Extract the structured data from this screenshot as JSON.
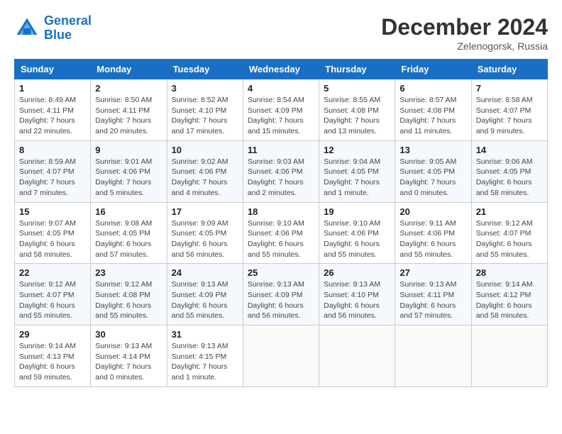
{
  "header": {
    "logo_line1": "General",
    "logo_line2": "Blue",
    "month_title": "December 2024",
    "location": "Zelenogorsk, Russia"
  },
  "weekdays": [
    "Sunday",
    "Monday",
    "Tuesday",
    "Wednesday",
    "Thursday",
    "Friday",
    "Saturday"
  ],
  "weeks": [
    [
      {
        "day": "1",
        "info": "Sunrise: 8:49 AM\nSunset: 4:11 PM\nDaylight: 7 hours\nand 22 minutes."
      },
      {
        "day": "2",
        "info": "Sunrise: 8:50 AM\nSunset: 4:11 PM\nDaylight: 7 hours\nand 20 minutes."
      },
      {
        "day": "3",
        "info": "Sunrise: 8:52 AM\nSunset: 4:10 PM\nDaylight: 7 hours\nand 17 minutes."
      },
      {
        "day": "4",
        "info": "Sunrise: 8:54 AM\nSunset: 4:09 PM\nDaylight: 7 hours\nand 15 minutes."
      },
      {
        "day": "5",
        "info": "Sunrise: 8:55 AM\nSunset: 4:08 PM\nDaylight: 7 hours\nand 13 minutes."
      },
      {
        "day": "6",
        "info": "Sunrise: 8:57 AM\nSunset: 4:08 PM\nDaylight: 7 hours\nand 11 minutes."
      },
      {
        "day": "7",
        "info": "Sunrise: 8:58 AM\nSunset: 4:07 PM\nDaylight: 7 hours\nand 9 minutes."
      }
    ],
    [
      {
        "day": "8",
        "info": "Sunrise: 8:59 AM\nSunset: 4:07 PM\nDaylight: 7 hours\nand 7 minutes."
      },
      {
        "day": "9",
        "info": "Sunrise: 9:01 AM\nSunset: 4:06 PM\nDaylight: 7 hours\nand 5 minutes."
      },
      {
        "day": "10",
        "info": "Sunrise: 9:02 AM\nSunset: 4:06 PM\nDaylight: 7 hours\nand 4 minutes."
      },
      {
        "day": "11",
        "info": "Sunrise: 9:03 AM\nSunset: 4:06 PM\nDaylight: 7 hours\nand 2 minutes."
      },
      {
        "day": "12",
        "info": "Sunrise: 9:04 AM\nSunset: 4:05 PM\nDaylight: 7 hours\nand 1 minute."
      },
      {
        "day": "13",
        "info": "Sunrise: 9:05 AM\nSunset: 4:05 PM\nDaylight: 7 hours\nand 0 minutes."
      },
      {
        "day": "14",
        "info": "Sunrise: 9:06 AM\nSunset: 4:05 PM\nDaylight: 6 hours\nand 58 minutes."
      }
    ],
    [
      {
        "day": "15",
        "info": "Sunrise: 9:07 AM\nSunset: 4:05 PM\nDaylight: 6 hours\nand 58 minutes."
      },
      {
        "day": "16",
        "info": "Sunrise: 9:08 AM\nSunset: 4:05 PM\nDaylight: 6 hours\nand 57 minutes."
      },
      {
        "day": "17",
        "info": "Sunrise: 9:09 AM\nSunset: 4:05 PM\nDaylight: 6 hours\nand 56 minutes."
      },
      {
        "day": "18",
        "info": "Sunrise: 9:10 AM\nSunset: 4:06 PM\nDaylight: 6 hours\nand 55 minutes."
      },
      {
        "day": "19",
        "info": "Sunrise: 9:10 AM\nSunset: 4:06 PM\nDaylight: 6 hours\nand 55 minutes."
      },
      {
        "day": "20",
        "info": "Sunrise: 9:11 AM\nSunset: 4:06 PM\nDaylight: 6 hours\nand 55 minutes."
      },
      {
        "day": "21",
        "info": "Sunrise: 9:12 AM\nSunset: 4:07 PM\nDaylight: 6 hours\nand 55 minutes."
      }
    ],
    [
      {
        "day": "22",
        "info": "Sunrise: 9:12 AM\nSunset: 4:07 PM\nDaylight: 6 hours\nand 55 minutes."
      },
      {
        "day": "23",
        "info": "Sunrise: 9:12 AM\nSunset: 4:08 PM\nDaylight: 6 hours\nand 55 minutes."
      },
      {
        "day": "24",
        "info": "Sunrise: 9:13 AM\nSunset: 4:09 PM\nDaylight: 6 hours\nand 55 minutes."
      },
      {
        "day": "25",
        "info": "Sunrise: 9:13 AM\nSunset: 4:09 PM\nDaylight: 6 hours\nand 56 minutes."
      },
      {
        "day": "26",
        "info": "Sunrise: 9:13 AM\nSunset: 4:10 PM\nDaylight: 6 hours\nand 56 minutes."
      },
      {
        "day": "27",
        "info": "Sunrise: 9:13 AM\nSunset: 4:11 PM\nDaylight: 6 hours\nand 57 minutes."
      },
      {
        "day": "28",
        "info": "Sunrise: 9:14 AM\nSunset: 4:12 PM\nDaylight: 6 hours\nand 58 minutes."
      }
    ],
    [
      {
        "day": "29",
        "info": "Sunrise: 9:14 AM\nSunset: 4:13 PM\nDaylight: 6 hours\nand 59 minutes."
      },
      {
        "day": "30",
        "info": "Sunrise: 9:13 AM\nSunset: 4:14 PM\nDaylight: 7 hours\nand 0 minutes."
      },
      {
        "day": "31",
        "info": "Sunrise: 9:13 AM\nSunset: 4:15 PM\nDaylight: 7 hours\nand 1 minute."
      },
      null,
      null,
      null,
      null
    ]
  ]
}
